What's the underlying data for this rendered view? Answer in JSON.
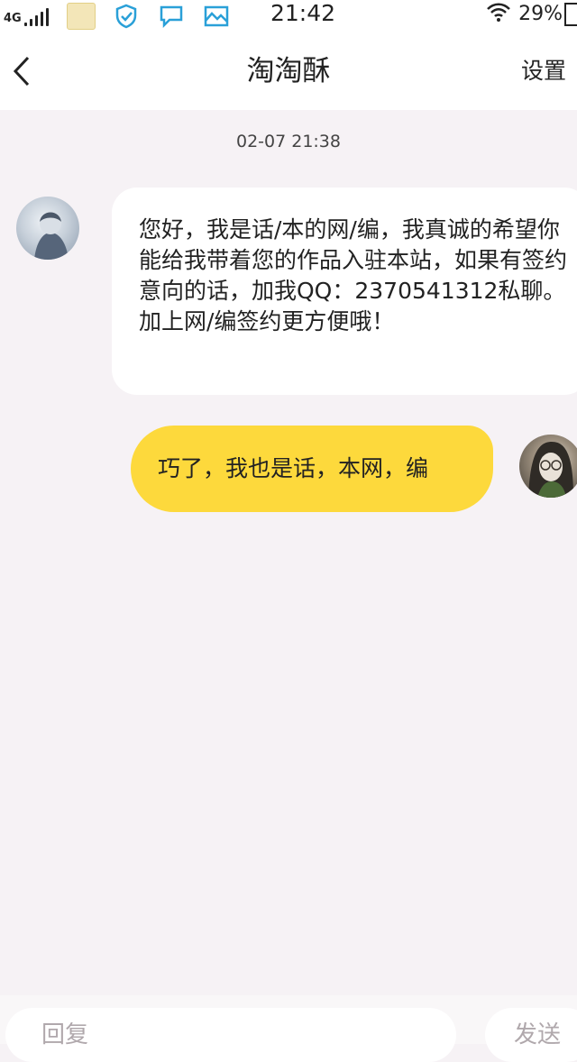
{
  "status_bar": {
    "network": "4G",
    "time": "21:42",
    "battery": "29%",
    "icons": [
      "app-notification-icon",
      "shield-icon",
      "chat-icon",
      "gallery-icon",
      "wifi-icon"
    ]
  },
  "header": {
    "back_icon": "back-arrow-icon",
    "title": "淘淘酥",
    "settings_label": "设置"
  },
  "chat": {
    "timestamp": "02-07 21:38",
    "messages": [
      {
        "direction": "incoming",
        "text": "您好，我是话/本的网/编，我真诚的希望你能给我带着您的作品入驻本站，如果有签约意向的话，加我QQ：2370541312私聊。加上网/编签约更方便哦！"
      },
      {
        "direction": "outgoing",
        "text": "巧了，我也是话，本网，编"
      }
    ]
  },
  "input": {
    "placeholder": "回复",
    "send_label": "发送"
  },
  "colors": {
    "background": "#f6f2f5",
    "outgoing_bubble": "#fdd93c",
    "incoming_bubble": "#ffffff"
  }
}
